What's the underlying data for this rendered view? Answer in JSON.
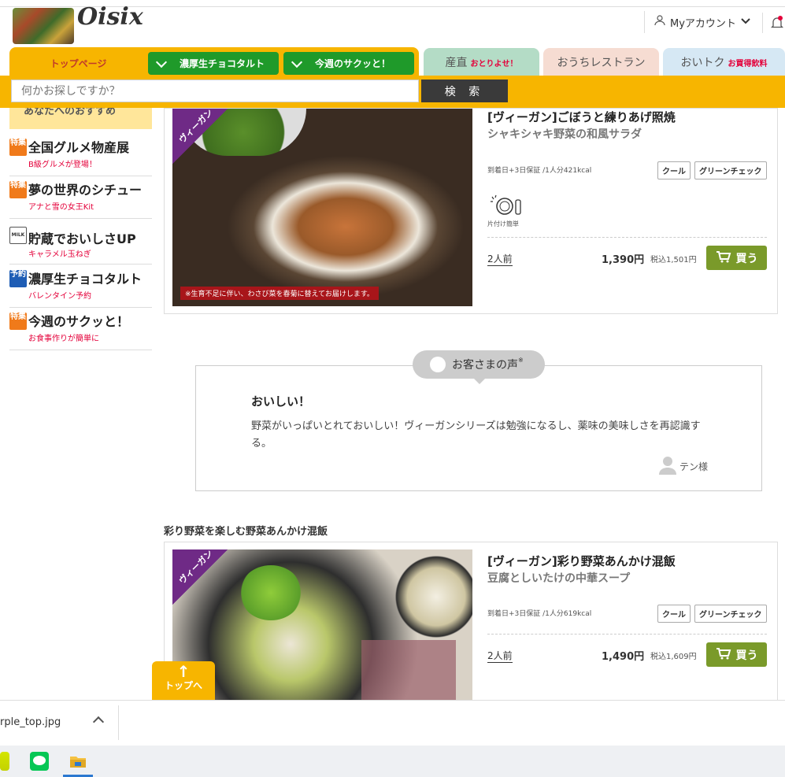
{
  "header": {
    "logo_text": "Oisix",
    "account_label": "Myアカウント"
  },
  "nav": {
    "top_label": "トップページ",
    "green_tabs": [
      "濃厚生チョコタルト",
      "今週のサクッと！"
    ],
    "tabs": [
      {
        "label": "産直",
        "sub": "おとりよせ！"
      },
      {
        "label": "おうちレストラン",
        "sub": ""
      },
      {
        "label": "おいトク",
        "sub": "お買得飲料"
      }
    ]
  },
  "search": {
    "placeholder": "何かお探しですか？",
    "button": "検 索"
  },
  "sidebar": {
    "heading": "あなたへのおすすめ",
    "items": [
      {
        "badge": "特集",
        "title": "全国グルメ物産展",
        "sub": "B級グルメが登場！",
        "badge_color": "#f07a1a"
      },
      {
        "badge": "特集",
        "title": "夢の世界のシチュー",
        "sub": "アナと雪の女王Kit",
        "badge_color": "#f07a1a"
      },
      {
        "badge": "MILK",
        "title": "貯蔵でおいしさUP",
        "sub": "キャラメル玉ねぎ",
        "badge_color": "#555555"
      },
      {
        "badge": "予約",
        "title": "濃厚生チョコタルト",
        "sub": "バレンタイン予約",
        "badge_color": "#1e5db5"
      },
      {
        "badge": "特集",
        "title": "今週のサクッと！",
        "sub": "お食事作りが簡単に",
        "badge_color": "#f07a1a"
      }
    ]
  },
  "product1": {
    "ribbon": "ヴィーガン",
    "img_note": "※生育不足に伴い、わさび菜を春菊に替えてお届けします。",
    "title": "[ヴィーガン]ごぼうと練りあげ照焼",
    "subtitle": "シャキシャキ野菜の和風サラダ",
    "meta": "到着日+3日保証 /1人分421kcal",
    "tags": [
      "クール",
      "グリーンチェック"
    ],
    "feature": "片付け簡単",
    "qty": "2人前",
    "price": "1,390円",
    "tax": "税込1,501円",
    "buy": "買う"
  },
  "review": {
    "label": "お客さまの声",
    "mark": "※",
    "title": "おいしい！",
    "body": "野菜がいっぱいとれておいしい！ヴィーガンシリーズは勉強になるし、薬味の美味しさを再認識する。",
    "user": "テン様"
  },
  "section2_title": "彩り野菜を楽しむ野菜あんかけ混飯",
  "product2": {
    "ribbon": "ヴィーガン",
    "title": "[ヴィーガン]彩り野菜あんかけ混飯",
    "subtitle": "豆腐としいたけの中華スープ",
    "meta": "到着日+3日保証 /1人分619kcal",
    "tags": [
      "クール",
      "グリーンチェック"
    ],
    "qty": "2人前",
    "price": "1,490円",
    "tax": "税込1,609円",
    "buy": "買う"
  },
  "to_top": "トップへ",
  "download": {
    "filename": "rple_top.jpg"
  },
  "colors": {
    "brand_yellow": "#f7b500",
    "green": "#1f9a2a",
    "buy_green": "#7a9a2a",
    "vegan_purple": "#6f2a86"
  }
}
